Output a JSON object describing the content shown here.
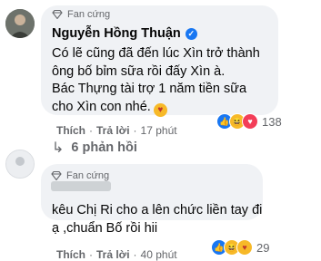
{
  "comment1": {
    "badge": "Fan cứng",
    "author": "Nguyễn Hồng Thuận",
    "lines": [
      "Có lẽ cũng đã đến lúc Xìn trở thành",
      "ông bố bỉm sữa rồi đấy Xìn à.",
      "Bác Thựng tài trợ 1 năm tiền sữa",
      "cho Xìn con nhé."
    ],
    "like": "Thích",
    "reply": "Trả lời",
    "time": "17 phút",
    "reaction_count": "138",
    "replies": "6 phản hồi"
  },
  "comment2": {
    "badge": "Fan cứng",
    "lines": [
      "kêu Chị Ri cho a lên chức liền tay đi",
      "ạ ,chuẩn Bố rồi hii"
    ],
    "like": "Thích",
    "reply": "Trả lời",
    "time": "40 phút",
    "reaction_count": "29"
  },
  "colors": {
    "accent": "#1877f2",
    "bubble": "#f0f2f5",
    "muted": "#65676b"
  },
  "icons": [
    "diamond-icon",
    "verified-icon",
    "like-reaction-icon",
    "haha-reaction-icon",
    "love-reaction-icon",
    "care-reaction-icon",
    "reply-arrow-icon"
  ]
}
